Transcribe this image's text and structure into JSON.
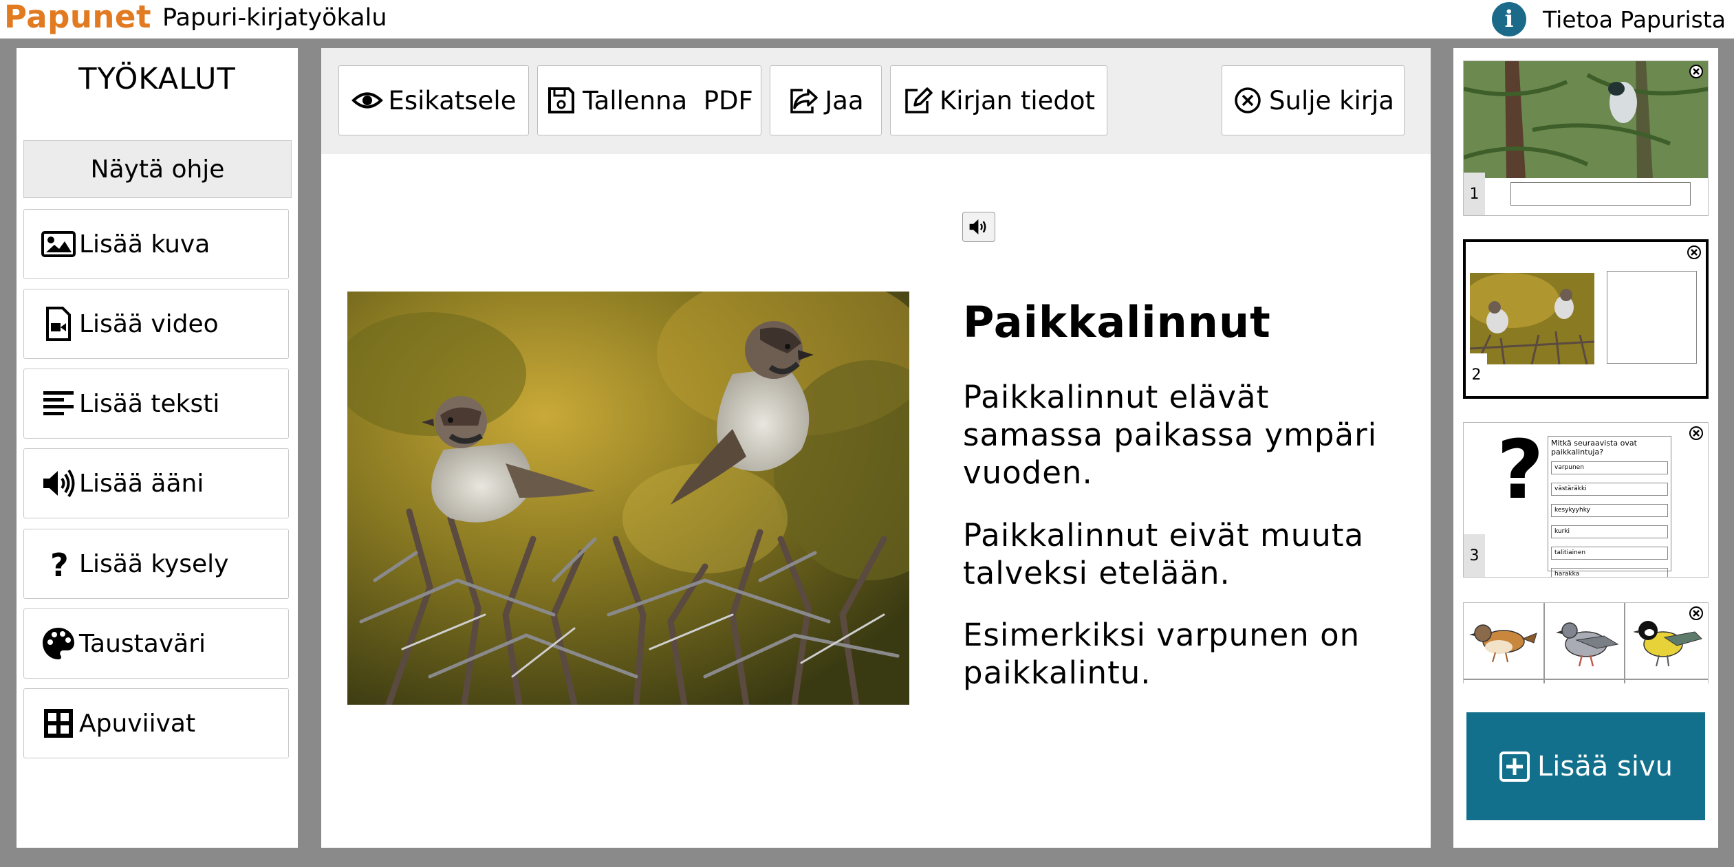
{
  "header": {
    "logo": "Papunet",
    "app_title": "Papuri-kirjatyökalu",
    "info_label": "Tietoa Papurista",
    "info_icon": "info-icon"
  },
  "tools": {
    "title": "TYÖKALUT",
    "help": "Näytä ohje",
    "items": [
      {
        "label": "Lisää kuva",
        "icon": "image-icon"
      },
      {
        "label": "Lisää video",
        "icon": "video-file-icon"
      },
      {
        "label": "Lisää teksti",
        "icon": "text-lines-icon"
      },
      {
        "label": "Lisää ääni",
        "icon": "speaker-icon"
      },
      {
        "label": "Lisää kysely",
        "icon": "question-icon"
      },
      {
        "label": "Taustaväri",
        "icon": "palette-icon"
      },
      {
        "label": "Apuviivat",
        "icon": "grid-icon"
      }
    ]
  },
  "toolbar": {
    "preview": "Esikatsele",
    "save_pdf": "Tallenna  PDF",
    "share": "Jaa",
    "book_info": "Kirjan tiedot",
    "close_book": "Sulje kirja"
  },
  "page": {
    "heading": "Paikkalinnut",
    "paragraphs": [
      "Paikkalinnut elävät samassa paikassa ympäri vuoden.",
      "Paikkalinnut eivät muuta talveksi etelään.",
      "Esimerkiksi varpunen on paikkalintu."
    ]
  },
  "pages": {
    "thumbs": [
      {
        "number": "1"
      },
      {
        "number": "2"
      },
      {
        "number": "3",
        "question": "Mitkä seuraavista ovat paikkalintuja?",
        "options": [
          "varpunen",
          "västäräkki",
          "kesykyyhky",
          "kurki",
          "talitiainen",
          "harakka"
        ]
      }
    ],
    "add_page": "Lisää sivu"
  },
  "colors": {
    "brand_orange": "#e17a20",
    "accent_teal": "#12708c",
    "info_blue": "#1b6a8a",
    "frame_gray": "#8a8a8a"
  }
}
